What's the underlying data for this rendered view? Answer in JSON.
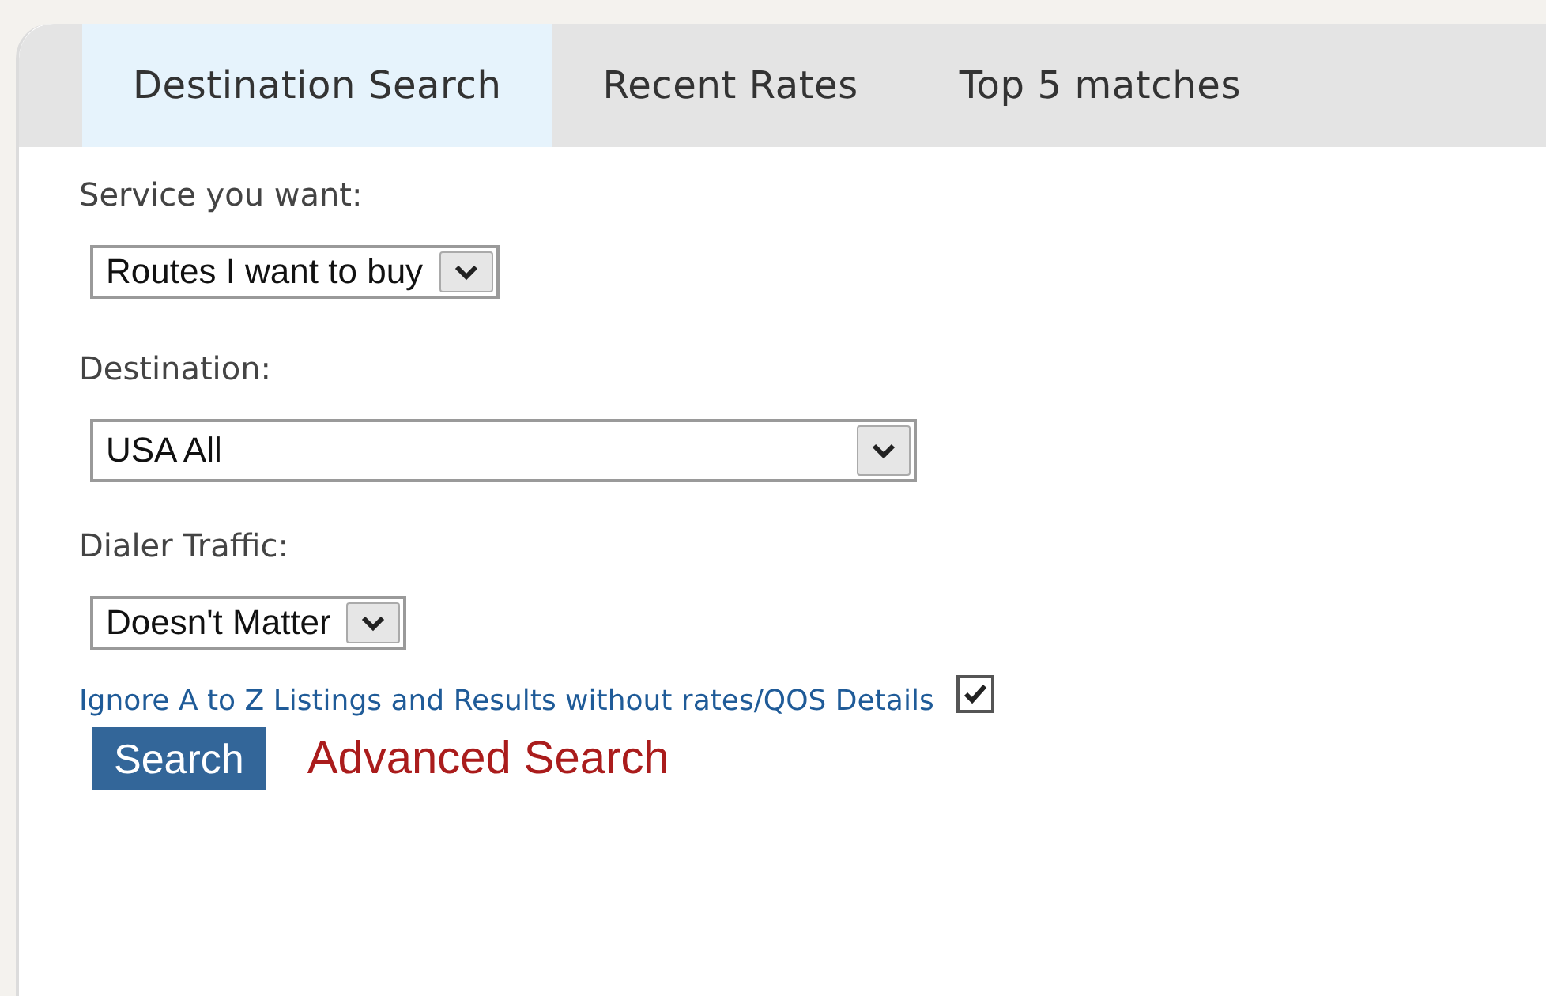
{
  "tabs": [
    {
      "label": "Destination Search",
      "selected": true
    },
    {
      "label": "Recent Rates",
      "selected": false
    },
    {
      "label": "Top 5 matches",
      "selected": false
    }
  ],
  "fields": [
    {
      "label": "Service you want:",
      "value": "Routes I want to buy"
    },
    {
      "label": "Destination:",
      "value": "USA All"
    },
    {
      "label": "Dialer Traffic:",
      "value": "Doesn't Matter"
    }
  ],
  "ignore_option": {
    "label": "Ignore A to Z Listings and Results without rates/QOS Details",
    "checked": true
  },
  "search_button": "Search",
  "advanced_link": "Advanced Search"
}
